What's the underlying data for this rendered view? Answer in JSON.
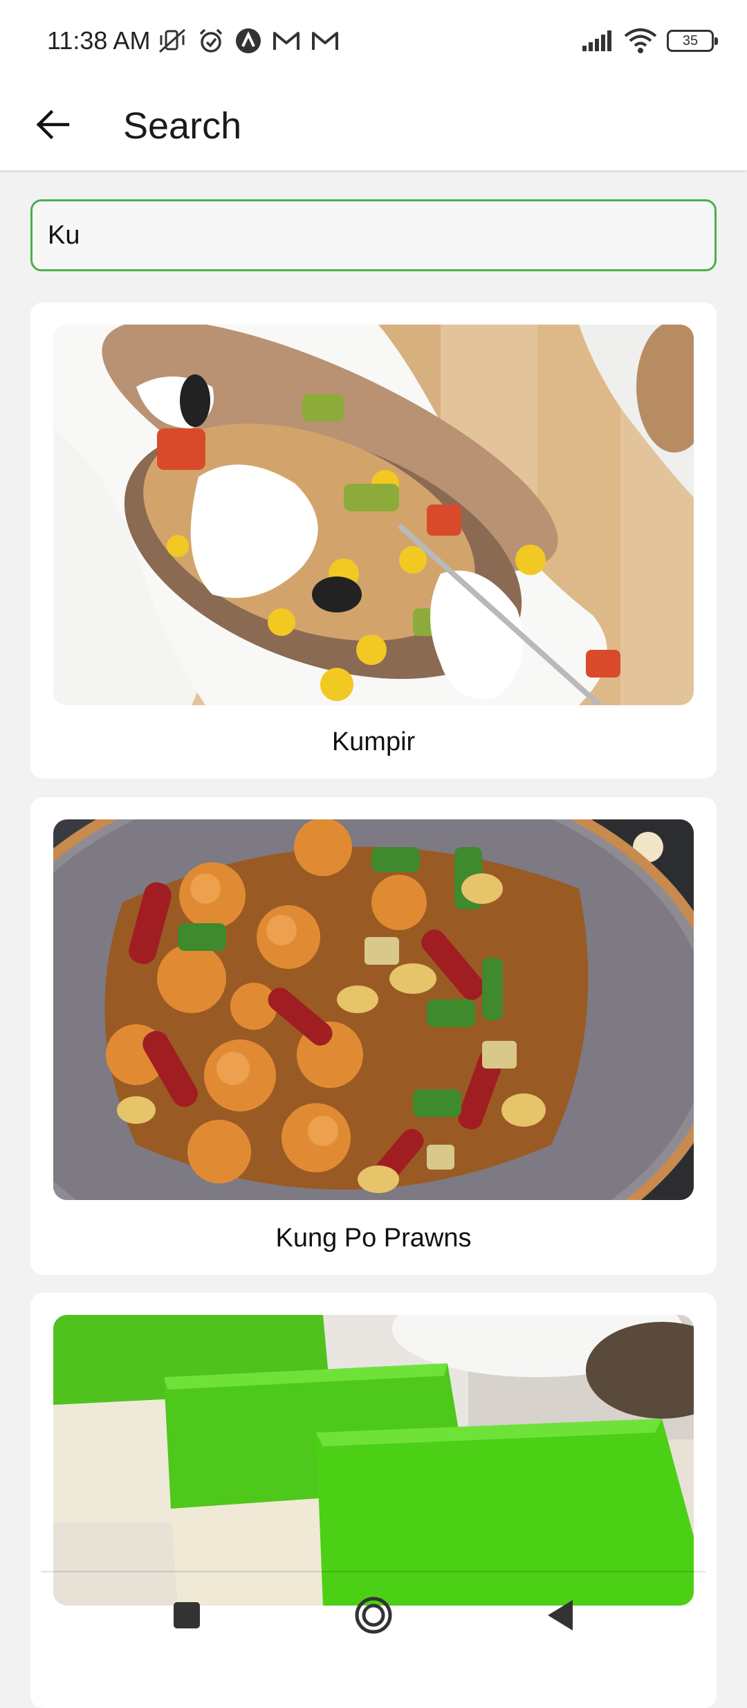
{
  "status_bar": {
    "time": "11:38 AM",
    "battery": "35",
    "icons": [
      "vibrate-off-icon",
      "alarm-icon",
      "app-notification-icon",
      "gmail-icon",
      "gmail-icon",
      "signal-icon",
      "wifi-icon",
      "battery-icon"
    ]
  },
  "app_bar": {
    "title": "Search",
    "back_icon": "arrow-left-icon"
  },
  "search": {
    "value": "Ku",
    "accent_color": "#4caf50"
  },
  "results": [
    {
      "name": "Kumpir",
      "image": "baked-potato-photo"
    },
    {
      "name": "Kung Po Prawns",
      "image": "kung-po-prawns-photo"
    },
    {
      "name": "",
      "image": "green-layered-cake-photo"
    }
  ],
  "nav_bar": {
    "icons": [
      "square-recents-icon",
      "circle-home-icon",
      "triangle-back-icon"
    ]
  }
}
